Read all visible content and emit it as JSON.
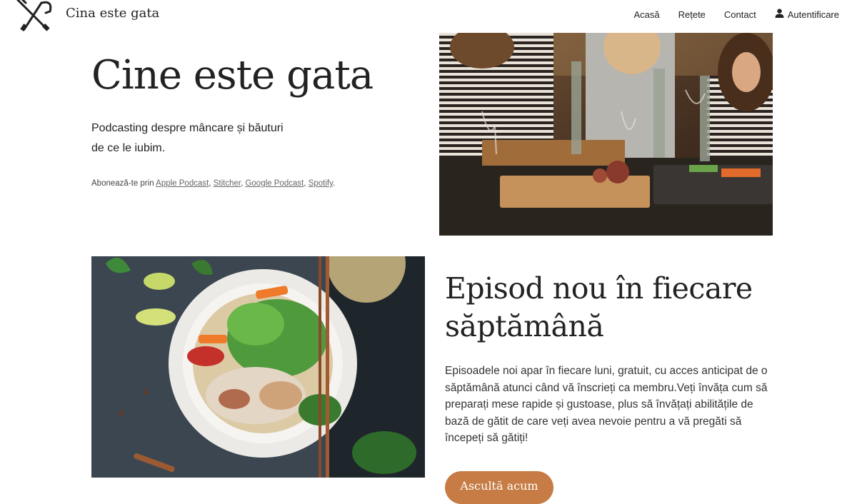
{
  "header": {
    "logo_icon": "fork-knife-icon",
    "site_title": "Cina este gata",
    "nav": [
      {
        "label": "Acasă"
      },
      {
        "label": "Rețete"
      },
      {
        "label": "Contact"
      },
      {
        "label": "Autentificare",
        "icon": "user-icon"
      }
    ]
  },
  "hero": {
    "title": "Cine este gata",
    "subtitle": "Podcasting despre mâncare și băuturi de ce le iubim.",
    "subscribe_prefix": "Abonează-te prin",
    "links": [
      "Apple Podcast",
      "Stitcher",
      "Google Podcast",
      "Spotify"
    ],
    "sep": ", ",
    "end": "."
  },
  "episode": {
    "title": "Episod nou în fiecare săptămână",
    "body": "Episoadele noi apar în fiecare luni, gratuit, cu acces anticipat de o săptămână atunci când vă înscrieți ca membru.Veți învăța cum să preparați mese rapide și gustoase, plus să învățați abilitățile de bază de gătit de care veți avea nevoie pentru a vă pregăti să începeți să gătiți!",
    "cta_label": "Ascultă acum"
  },
  "colors": {
    "accent": "#c67c44",
    "text": "#222222"
  }
}
